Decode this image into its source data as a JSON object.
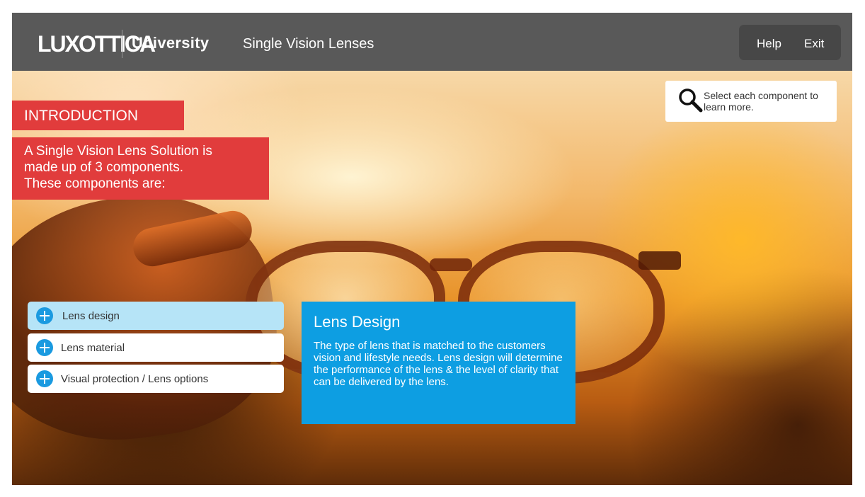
{
  "header": {
    "logo_wordmark": "LUXOTTICA",
    "logo_suffix": "University",
    "course_title": "Single Vision Lenses",
    "help_label": "Help",
    "exit_label": "Exit"
  },
  "intro": {
    "label": "INTRODUCTION",
    "text_lines": [
      "A Single Vision Lens Solution is",
      "made up  of 3 components.",
      "These components are:"
    ]
  },
  "hint": {
    "icon": "magnifier-icon",
    "text": "Select each component to learn more."
  },
  "components": [
    {
      "label": "Lens design",
      "active": true
    },
    {
      "label": "Lens material",
      "active": false
    },
    {
      "label": "Visual protection / Lens options",
      "active": false
    }
  ],
  "info_panel": {
    "title": "Lens Design",
    "body": "The type of lens that is matched to the customers vision and lifestyle needs. Lens design will determine the performance of the lens &  the level of clarity that can be delivered by the lens."
  },
  "colors": {
    "header_bg": "#595959",
    "accent_red": "#e13c3c",
    "accent_blue": "#0d9ee2",
    "active_item_bg": "#b6e4f7"
  }
}
